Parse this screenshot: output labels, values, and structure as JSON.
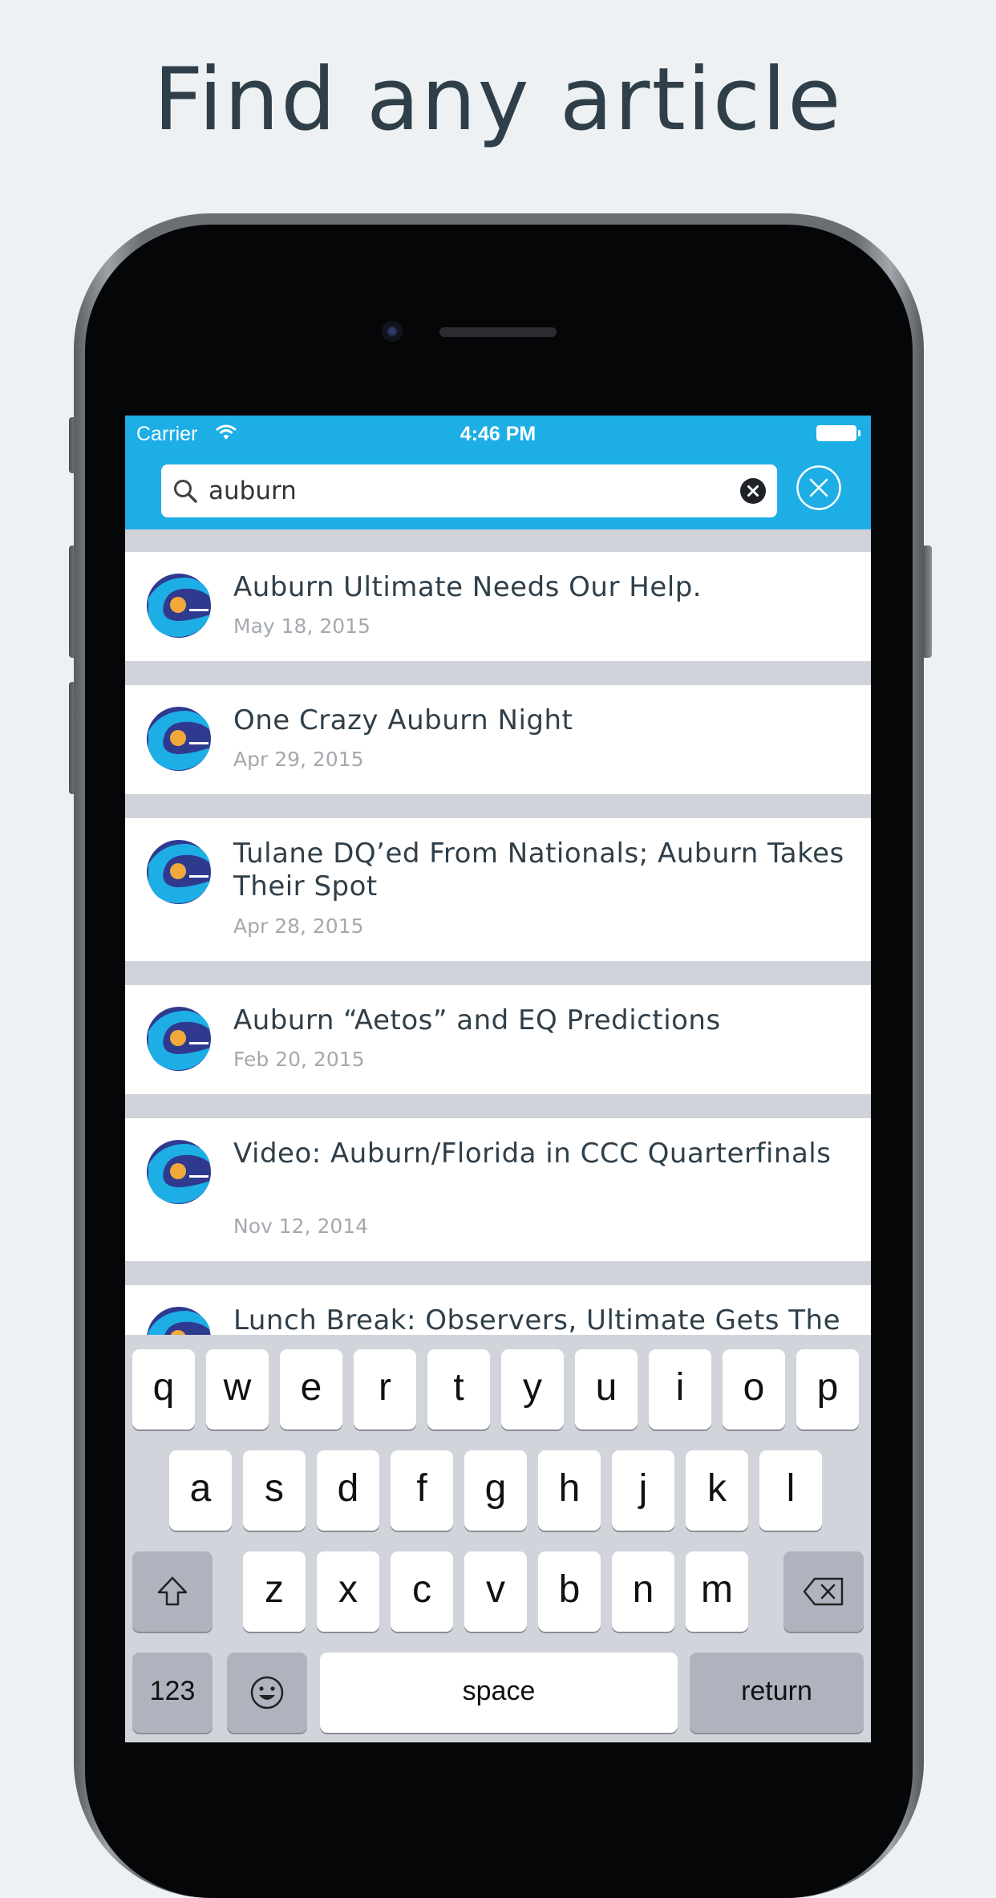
{
  "headline": "Find any article",
  "status_bar": {
    "carrier": "Carrier",
    "time": "4:46 PM"
  },
  "search": {
    "query": "auburn"
  },
  "results": [
    {
      "title": "Auburn Ultimate Needs Our Help.",
      "date": "May 18, 2015"
    },
    {
      "title": "One Crazy Auburn Night",
      "date": "Apr 29, 2015"
    },
    {
      "title": "Tulane DQ’ed From Nationals; Auburn Takes Their Spot",
      "date": "Apr 28, 2015"
    },
    {
      "title": "Auburn “Aetos” and EQ Predictions",
      "date": "Feb 20, 2015"
    },
    {
      "title": "Video: Auburn/Florida in CCC Quarterfinals",
      "date": "Nov 12, 2014"
    },
    {
      "title": "Lunch Break: Observers, Ultimate Gets The",
      "date": ""
    }
  ],
  "keyboard": {
    "row1": [
      "q",
      "w",
      "e",
      "r",
      "t",
      "y",
      "u",
      "i",
      "o",
      "p"
    ],
    "row2": [
      "a",
      "s",
      "d",
      "f",
      "g",
      "h",
      "j",
      "k",
      "l"
    ],
    "row3": [
      "z",
      "x",
      "c",
      "v",
      "b",
      "n",
      "m"
    ],
    "numbers_label": "123",
    "space_label": "space",
    "return_label": "return"
  },
  "colors": {
    "accent": "#1eaee6",
    "background": "#eef1f4",
    "title_text": "#2f3f4a",
    "date_text": "#a4a9ae"
  }
}
